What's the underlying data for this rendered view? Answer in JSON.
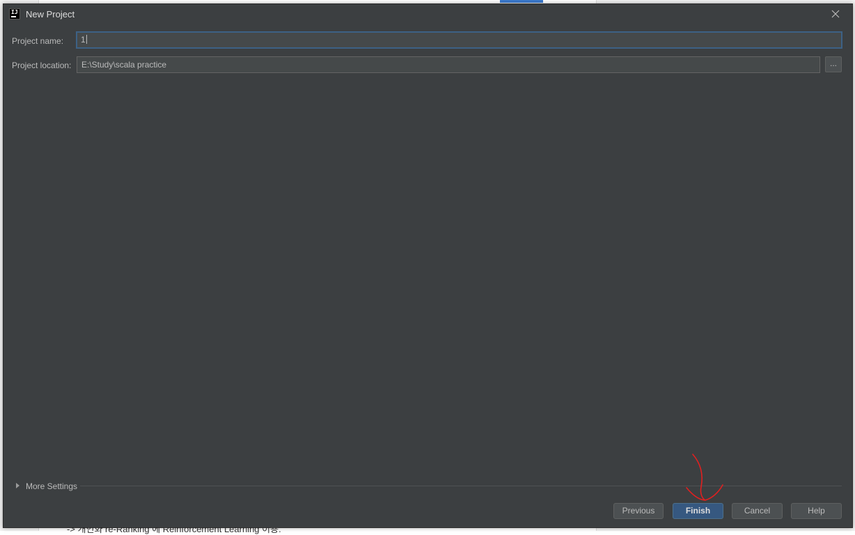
{
  "background": {
    "text": "-> 개인화 re-Ranking 에 Reinforcement Learning 이용."
  },
  "dialog": {
    "title": "New Project",
    "app_icon_text": "IJ"
  },
  "form": {
    "project_name_label": "Project name:",
    "project_name_value": "1",
    "project_location_label": "Project location:",
    "project_location_value": "E:\\Study\\scala practice",
    "browse_label": "..."
  },
  "more_settings": {
    "label": "More Settings"
  },
  "buttons": {
    "previous": "Previous",
    "finish": "Finish",
    "cancel": "Cancel",
    "help": "Help"
  },
  "colors": {
    "dialog_bg": "#3c3f41",
    "primary_button": "#365880",
    "annotation": "#e02020"
  }
}
